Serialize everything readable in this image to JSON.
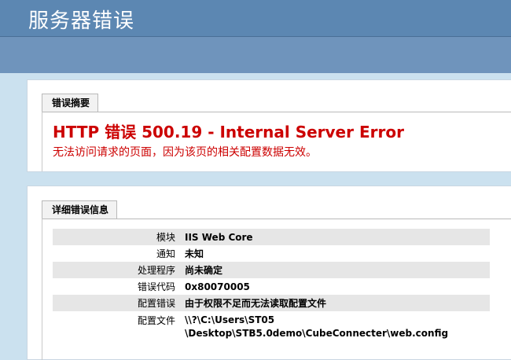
{
  "header": {
    "title": "服务器错误"
  },
  "summary": {
    "tab_label": "错误摘要",
    "error_title": "HTTP 错误 500.19 - Internal Server Error",
    "error_description": "无法访问请求的页面，因为该页的相关配置数据无效。"
  },
  "detail": {
    "tab_label": "详细错误信息",
    "rows": [
      {
        "key": "模块",
        "value": "IIS Web Core"
      },
      {
        "key": "通知",
        "value": "未知"
      },
      {
        "key": "处理程序",
        "value": "尚未确定"
      },
      {
        "key": "错误代码",
        "value": "0x80070005"
      },
      {
        "key": "配置错误",
        "value": "由于权限不足而无法读取配置文件"
      },
      {
        "key": "配置文件",
        "value_line1": "\\\\?\\C:\\Users\\ST05",
        "value_line2": "\\Desktop\\STB5.0demo\\CubeConnecter\\web.config"
      }
    ]
  },
  "colors": {
    "header_bg": "#5c87b2",
    "page_bg": "#cbe1ef",
    "error_red": "#cc0000"
  }
}
